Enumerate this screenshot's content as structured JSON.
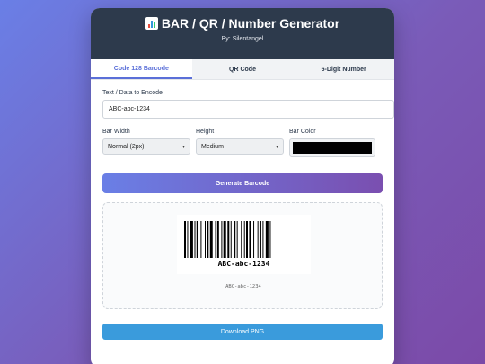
{
  "header": {
    "title": "BAR / QR / Number Generator",
    "byline": "By: Silentangel",
    "title_icon": "bar-chart-icon"
  },
  "tabs": [
    {
      "label": "Code 128 Barcode",
      "active": true
    },
    {
      "label": "QR Code",
      "active": false
    },
    {
      "label": "6-Digit Number",
      "active": false
    }
  ],
  "form": {
    "text_label": "Text / Data to Encode",
    "text_value": "ABC-abc-1234",
    "bar_width_label": "Bar Width",
    "bar_width_value": "Normal (2px)",
    "height_label": "Height",
    "height_value": "Medium",
    "bar_color_label": "Bar Color",
    "bar_color_value": "#000000"
  },
  "buttons": {
    "generate": "Generate Barcode",
    "download": "Download PNG"
  },
  "preview": {
    "barcode_text": "ABC-abc-1234",
    "caption": "ABC-abc-1234"
  },
  "colors": {
    "header_bg": "#2d3a4c",
    "accent": "#5a6fd8",
    "download_bg": "#3a9bdc"
  }
}
